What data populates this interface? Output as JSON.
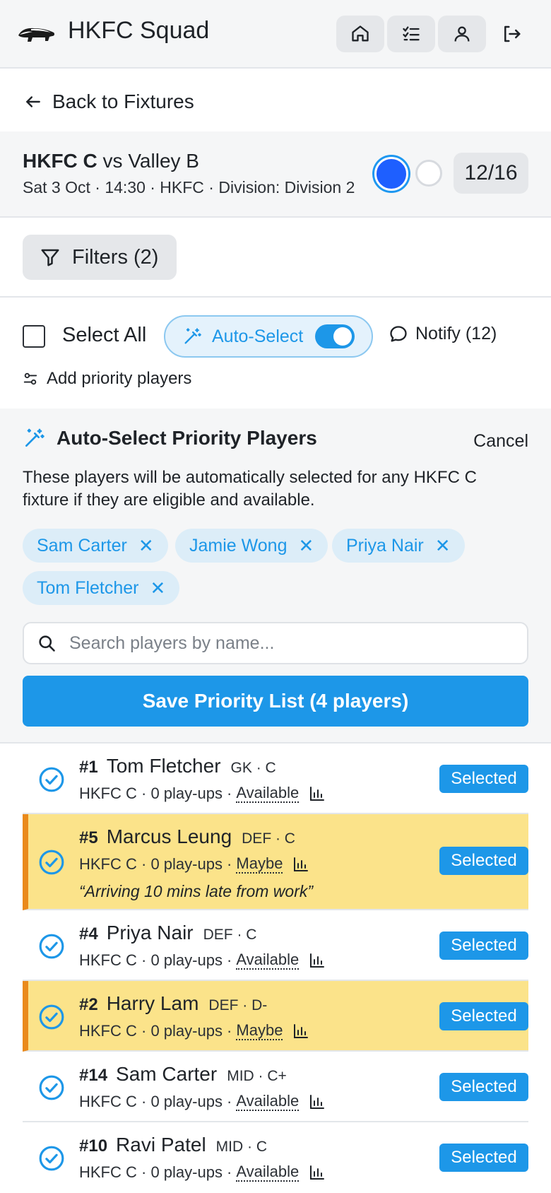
{
  "header": {
    "title": "HKFC Squad",
    "icons": [
      "badger-logo",
      "home-icon",
      "checklist-icon",
      "user-icon",
      "logout-icon"
    ]
  },
  "nav": {
    "back_label": "Back to Fixtures"
  },
  "fixture": {
    "team": "HKFC C",
    "vs": "vs Valley B",
    "details": "Sat 3 Oct · 14:30 · HKFC · Division: Division 2",
    "count": "12/16",
    "colors": {
      "accent": "#1d97e8",
      "home_dot": "#1e5fff"
    }
  },
  "filters": {
    "label": "Filters (2)"
  },
  "actions": {
    "select_all": "Select All",
    "auto_select": "Auto-Select",
    "auto_select_on": true,
    "notify": "Notify (12)",
    "add_priority": "Add priority players"
  },
  "priority": {
    "title": "Auto-Select Priority Players",
    "cancel": "Cancel",
    "description": "These players will be automatically selected for any HKFC C fixture if they are eligible and available.",
    "chips": [
      "Sam Carter",
      "Jamie Wong",
      "Priya Nair",
      "Tom Fletcher"
    ],
    "search_placeholder": "Search players by name...",
    "save_label": "Save Priority List (4 players)"
  },
  "players": [
    {
      "num": "#1",
      "name": "Tom Fletcher",
      "meta": "GK · C",
      "team": "HKFC C · 0 play-ups ·",
      "status": "Available",
      "note": "",
      "selected": "Selected"
    },
    {
      "num": "#5",
      "name": "Marcus Leung",
      "meta": "DEF · C",
      "team": "HKFC C · 0 play-ups ·",
      "status": "Maybe",
      "note": "“Arriving 10 mins late from work”",
      "selected": "Selected"
    },
    {
      "num": "#4",
      "name": "Priya Nair",
      "meta": "DEF · C",
      "team": "HKFC C · 0 play-ups ·",
      "status": "Available",
      "note": "",
      "selected": "Selected"
    },
    {
      "num": "#2",
      "name": "Harry Lam",
      "meta": "DEF · D-",
      "team": "HKFC C · 0 play-ups ·",
      "status": "Maybe",
      "note": "",
      "selected": "Selected"
    },
    {
      "num": "#14",
      "name": "Sam Carter",
      "meta": "MID · C+",
      "team": "HKFC C · 0 play-ups ·",
      "status": "Available",
      "note": "",
      "selected": "Selected"
    },
    {
      "num": "#10",
      "name": "Ravi Patel",
      "meta": "MID · C",
      "team": "HKFC C · 0 play-ups ·",
      "status": "Available",
      "note": "",
      "selected": "Selected"
    }
  ]
}
